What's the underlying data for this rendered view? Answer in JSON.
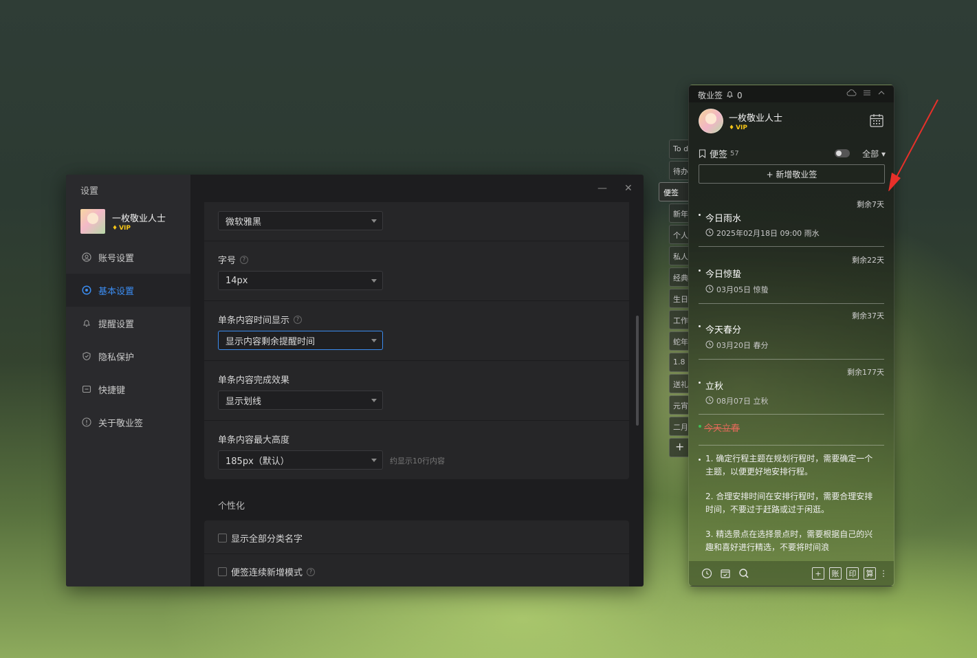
{
  "settings": {
    "title": "设置",
    "user": {
      "name": "一枚敬业人士",
      "vip": "VIP"
    },
    "menu": [
      {
        "label": "账号设置"
      },
      {
        "label": "基本设置"
      },
      {
        "label": "提醒设置"
      },
      {
        "label": "隐私保护"
      },
      {
        "label": "快捷键"
      },
      {
        "label": "关于敬业签"
      }
    ],
    "font_family": {
      "value": "微软雅黑"
    },
    "font_size": {
      "label": "字号",
      "value": "14px"
    },
    "time_display": {
      "label": "单条内容时间显示",
      "value": "显示内容剩余提醒时间"
    },
    "complete_effect": {
      "label": "单条内容完成效果",
      "value": "显示划线"
    },
    "max_height": {
      "label": "单条内容最大高度",
      "value": "185px（默认）",
      "hint": "约显示10行内容"
    },
    "personalize": {
      "title": "个性化",
      "show_all_category": "显示全部分类名字",
      "continuous_add": "便签连续新增模式"
    }
  },
  "side_tabs": [
    "To d",
    "待办",
    "便签",
    "新年",
    "个人",
    "私人",
    "经典",
    "生日",
    "工作",
    "蛇年",
    "1.8",
    "送礼",
    "元宵",
    "二月",
    "+"
  ],
  "notes_panel": {
    "app_name": "敬业签",
    "notify_count": "0",
    "user": {
      "name": "一枚敬业人士",
      "vip": "VIP"
    },
    "filter": {
      "label": "便签",
      "count": "57",
      "scope": "全部"
    },
    "new_button": "+ 新增敬业签",
    "items": [
      {
        "remain": "剩余7天",
        "title": "今日雨水",
        "time": "2025年02月18日 09:00 雨水"
      },
      {
        "remain": "剩余22天",
        "title": "今日惊蛰",
        "time": "03月05日 惊蛰"
      },
      {
        "remain": "剩余37天",
        "title": "今天春分",
        "time": "03月20日 春分"
      },
      {
        "remain": "剩余177天",
        "title": "立秋",
        "time": "08月07日 立秋"
      }
    ],
    "done_item": "今天立春",
    "long_item": {
      "p1": "1. 确定行程主题在规划行程时，需要确定一个主题，以便更好地安排行程。",
      "p2": "2. 合理安排时间在安排行程时，需要合理安排时间，不要过于赶路或过于闲逛。",
      "p3": "3. 精选景点在选择景点时，需要根据自己的兴趣和喜好进行精选，不要将时间浪"
    },
    "bottom_buttons": [
      "账",
      "印",
      "算"
    ]
  },
  "colors": {
    "accent": "#3b8df2",
    "done_text": "#e36a5a",
    "arrow": "#e8302a"
  }
}
